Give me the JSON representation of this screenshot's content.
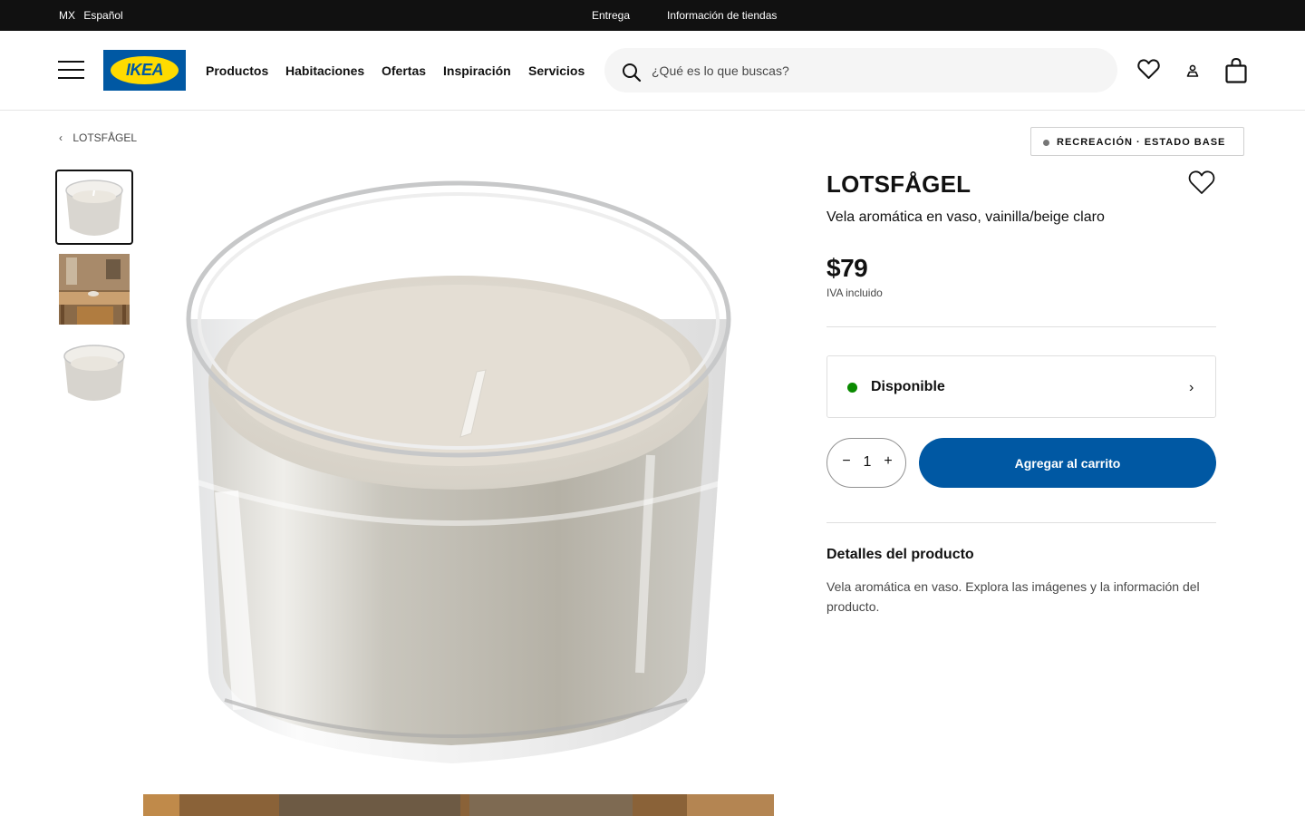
{
  "topbar": {
    "country": "MX",
    "language": "Español",
    "delivery": "Entrega",
    "store_info": "Información de tiendas"
  },
  "header": {
    "logo_text": "IKEA",
    "nav": [
      "Productos",
      "Habitaciones",
      "Ofertas",
      "Inspiración",
      "Servicios"
    ],
    "search_placeholder": "¿Qué es lo que buscas?",
    "icons": [
      "menu-icon",
      "search-icon",
      "heart-icon",
      "user-icon",
      "shopping-bag-icon"
    ]
  },
  "breadcrumb": {
    "label": "LOTSFÅGEL"
  },
  "badge": {
    "label": "RECREACIÓN · ESTADO BASE"
  },
  "product": {
    "name": "LOTSFÅGEL",
    "description": "Vela aromática en vaso, vainilla/beige claro",
    "price": "$79",
    "vat_note": "IVA incluido",
    "availability": "Disponible",
    "availability_color": "#0a8a00",
    "quantity": "1",
    "minus_symbol": "−",
    "plus_symbol": "+",
    "add_to_cart": "Agregar al carrito",
    "details_title": "Detalles del producto",
    "details_text": "Vela aromática en vaso. Explora las imágenes y la información del producto."
  },
  "colors": {
    "brand_blue": "#0058a3",
    "brand_yellow": "#ffdb00",
    "topbar_bg": "#111111"
  }
}
